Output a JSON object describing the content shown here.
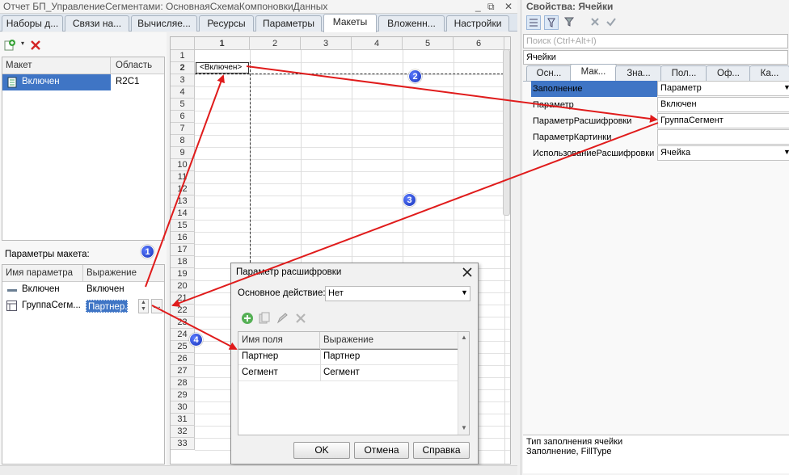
{
  "window": {
    "title": "Отчет БП_УправлениеСегментами: ОсновнаяСхемаКомпоновкиДанных",
    "controls": [
      "_",
      "⧉",
      "✕"
    ]
  },
  "tabs": [
    {
      "label": "Наборы д..."
    },
    {
      "label": "Связи на..."
    },
    {
      "label": "Вычисляе..."
    },
    {
      "label": "Ресурсы"
    },
    {
      "label": "Параметры"
    },
    {
      "label": "Макеты"
    },
    {
      "label": "Вложенн..."
    },
    {
      "label": "Настройки"
    }
  ],
  "active_tab": "Макеты",
  "layouts_table": {
    "headers": [
      "Макет",
      "Область"
    ],
    "rows": [
      {
        "name": "Включен",
        "area": "R2C1"
      }
    ]
  },
  "params_section": {
    "label": "Параметры макета:",
    "headers": [
      "Имя параметра",
      "Выражение"
    ],
    "rows": [
      {
        "name": "Включен",
        "expr": "Включен"
      },
      {
        "name": "ГруппаСегм...",
        "expr": "Партнер."
      }
    ],
    "ellipsis": "..."
  },
  "spreadsheet": {
    "columns": [
      "1",
      "2",
      "3",
      "4",
      "5",
      "6"
    ],
    "rows": [
      "1",
      "2",
      "3",
      "4",
      "5",
      "6",
      "7",
      "8",
      "9",
      "10",
      "11",
      "12",
      "13",
      "14",
      "15",
      "16",
      "17",
      "18",
      "19",
      "20",
      "21",
      "22",
      "23",
      "24",
      "25",
      "26",
      "27",
      "28",
      "29",
      "30",
      "31",
      "32",
      "33"
    ],
    "cell_r2c1": "<Включен>"
  },
  "properties": {
    "title": "Свойства: Ячейки",
    "search_placeholder": "Поиск (Ctrl+Alt+I)",
    "object_field": "Ячейки",
    "tabs": [
      "Осн...",
      "Мак...",
      "Зна...",
      "Пол...",
      "Оф...",
      "Ка..."
    ],
    "rows": [
      {
        "name": "Заполнение",
        "value": "Параметр"
      },
      {
        "name": "Параметр",
        "value": "Включен"
      },
      {
        "name": "ПараметрРасшифровки",
        "value": "ГруппаСегмент"
      },
      {
        "name": "ПараметрКартинки",
        "value": ""
      },
      {
        "name": "ИспользованиеРасшифровки",
        "value": "Ячейка"
      }
    ],
    "footer_title": "Тип заполнения ячейки",
    "footer_text": "Заполнение, FillType"
  },
  "dialog": {
    "title": "Параметр расшифровки",
    "main_action_label": "Основное действие:",
    "main_action_value": "Нет",
    "headers": [
      "Имя поля",
      "Выражение"
    ],
    "rows": [
      {
        "field": "Партнер",
        "expr": "Партнер"
      },
      {
        "field": "Сегмент",
        "expr": "Сегмент"
      }
    ],
    "ok_label": "OK",
    "cancel_label": "Отмена",
    "help_label": "Справка"
  },
  "callouts": [
    "1",
    "2",
    "3",
    "4"
  ],
  "colors": {
    "arrow": "#e01b1b",
    "badge": "#1f3fd6",
    "selection": "#3f75c5"
  }
}
